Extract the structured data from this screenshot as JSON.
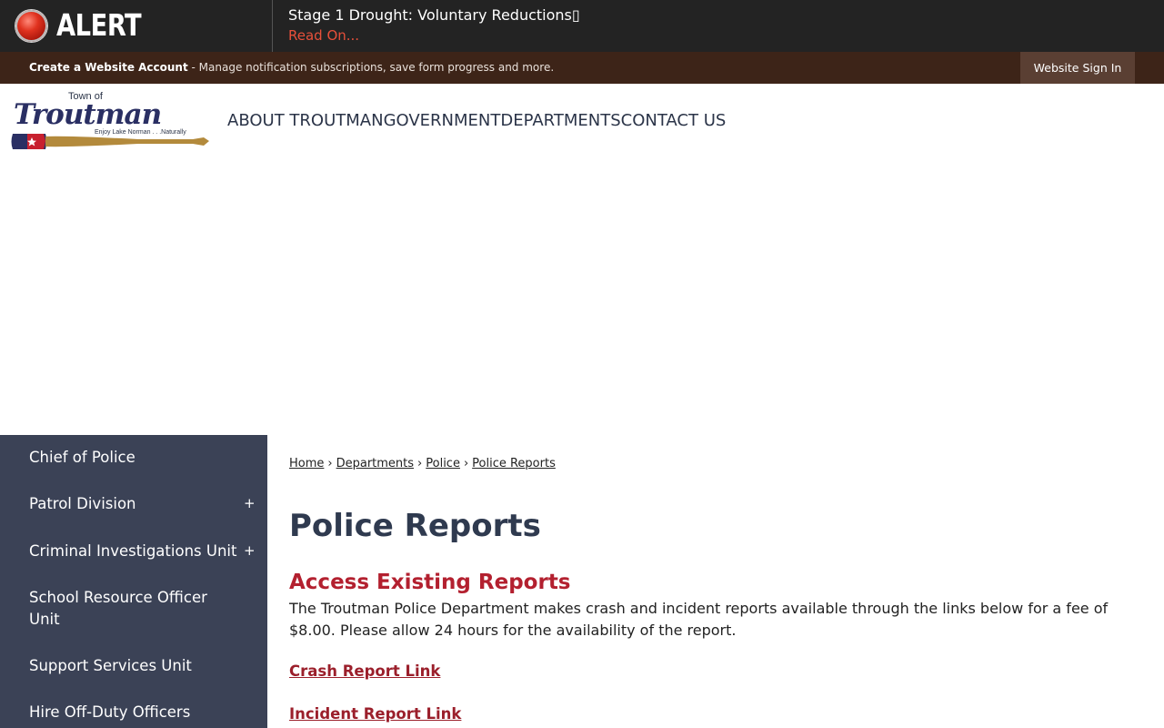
{
  "alert": {
    "label": "ALERT",
    "message": "Stage 1 Drought: Voluntary Reductions▯",
    "link": "Read On..."
  },
  "account_bar": {
    "create_label": "Create a Website Account",
    "description": " - Manage notification subscriptions, save form progress and more.",
    "signin_label": "Website Sign In"
  },
  "logo": {
    "town_of": "Town of",
    "name": "Troutman",
    "tagline": "Enjoy Lake Norman . . .Naturally"
  },
  "nav": {
    "items": [
      "ABOUT TROUTMAN",
      "GOVERNMENT",
      "DEPARTMENTS",
      "CONTACT US"
    ]
  },
  "sidebar": {
    "items": [
      {
        "label": "Chief of Police"
      },
      {
        "label": "Patrol Division",
        "expand": "+"
      },
      {
        "label": "Criminal Investigations Unit",
        "expand": "+"
      },
      {
        "label": "School Resource Officer Unit"
      },
      {
        "label": "Support Services Unit"
      },
      {
        "label": "Hire Off-Duty Officers"
      }
    ]
  },
  "breadcrumb": {
    "items": [
      "Home",
      "Departments",
      "Police",
      "Police Reports"
    ],
    "separator": "›"
  },
  "content": {
    "title": "Police Reports",
    "section_title": "Access Existing Reports",
    "body": "The Troutman Police Department makes crash and incident reports available through the links below for a fee of $8.00. Please allow 24 hours for the availability of the report.",
    "links": [
      "Crash Report Link",
      "Incident Report Link"
    ]
  },
  "colors": {
    "alert_bg": "#232323",
    "account_bar_bg": "#3d2418",
    "sidebar_bg": "#3b4256",
    "accent_red": "#b3202f",
    "title_navy": "#2f3a4f"
  }
}
